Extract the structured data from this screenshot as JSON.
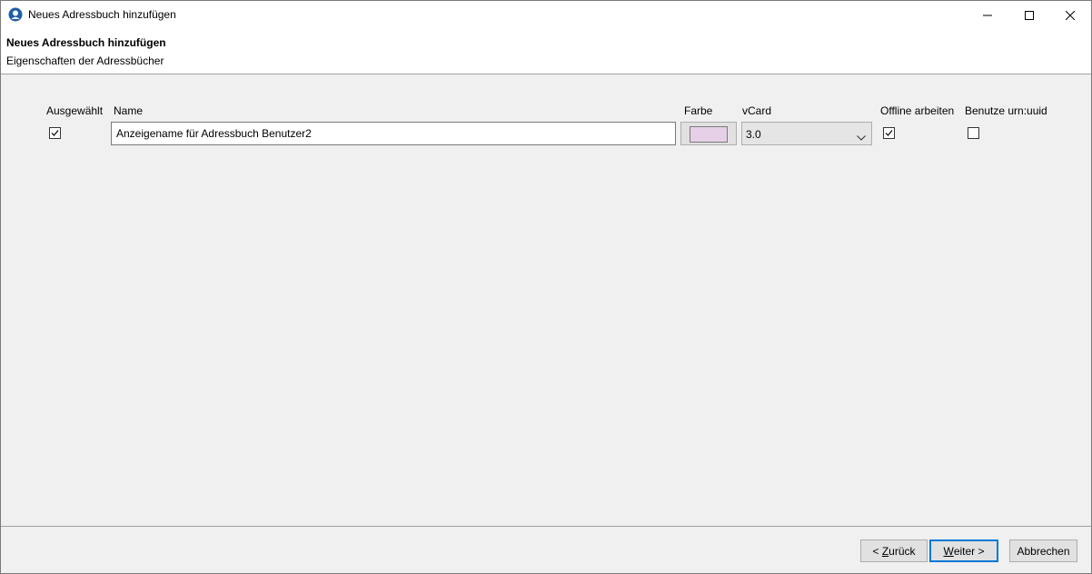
{
  "window": {
    "title": "Neues Adressbuch hinzufügen"
  },
  "header": {
    "title": "Neues Adressbuch hinzufügen",
    "subtitle": "Eigenschaften der Adressbücher"
  },
  "table": {
    "columns": {
      "selected": "Ausgewählt",
      "name": "Name",
      "color": "Farbe",
      "vcard": "vCard",
      "offline": "Offline arbeiten",
      "urn_uuid": "Benutze urn:uuid"
    },
    "row": {
      "selected": true,
      "name_value": "Anzeigename für Adressbuch Benutzer2",
      "color": "#e6d0e8",
      "vcard_value": "3.0",
      "offline": true,
      "urn_uuid": false
    }
  },
  "footer": {
    "back_prefix": "< ",
    "back_hotkey": "Z",
    "back_rest": "urück",
    "next_hotkey": "W",
    "next_rest": "eiter >",
    "cancel_label": "Abbrechen"
  },
  "icons": {
    "app": "address-book-app-icon",
    "minimize": "minimize-icon",
    "maximize": "maximize-icon",
    "close": "close-icon",
    "check": "checkmark-icon",
    "chevron": "chevron-down-icon"
  },
  "colors": {
    "accent": "#0078d7",
    "background": "#f0f0f0"
  }
}
